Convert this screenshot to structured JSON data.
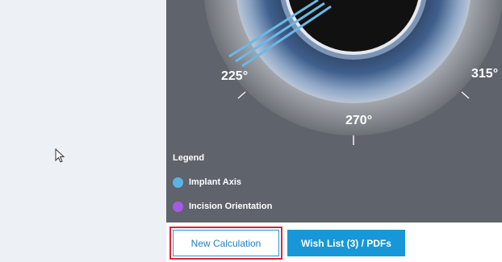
{
  "diagram": {
    "angle_labels": {
      "left": "225°",
      "bottom": "270°",
      "right": "315°"
    }
  },
  "legend": {
    "title": "Legend",
    "items": [
      {
        "label": "Implant Axis",
        "color": "#57b4e5"
      },
      {
        "label": "Incision Orientation",
        "color": "#a55ae7"
      }
    ]
  },
  "actions": {
    "new_calculation_label": "New Calculation",
    "wish_list_label": "Wish List (3) / PDFs"
  },
  "colors": {
    "accent": "#1797d7",
    "highlight": "#e1252f",
    "panel_bg": "#5f636b"
  }
}
